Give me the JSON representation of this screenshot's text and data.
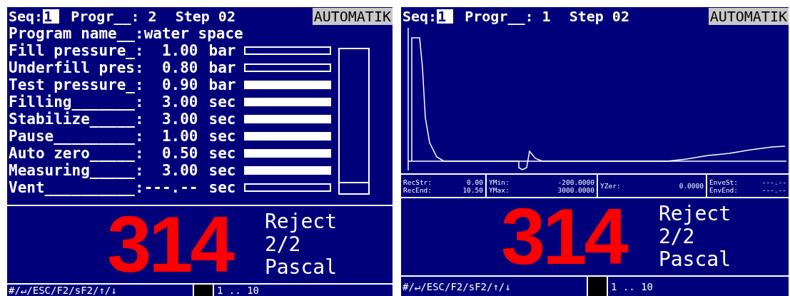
{
  "panels": [
    {
      "kind": "parameters",
      "header": {
        "seq_label": "Seq:",
        "seq_value": "1",
        "program": "Progr__: 2",
        "step": "Step 02",
        "mode": "AUTOMATIK"
      },
      "program_name": "Program name__:water space",
      "parameters": [
        {
          "label": "Fill pressure_:",
          "value": "1.00",
          "unit": "bar",
          "filled": false
        },
        {
          "label": "Underfill pres:",
          "value": "0.80",
          "unit": "bar",
          "filled": false
        },
        {
          "label": "Test pressure_:",
          "value": "0.90",
          "unit": "bar",
          "filled": true
        },
        {
          "label": "Filling_______:",
          "value": "3.00",
          "unit": "sec",
          "filled": true
        },
        {
          "label": "Stabilize_____:",
          "value": "3.00",
          "unit": "sec",
          "filled": true
        },
        {
          "label": "Pause_________:",
          "value": "1.00",
          "unit": "sec",
          "filled": true
        },
        {
          "label": "Auto zero_____:",
          "value": "0.50",
          "unit": "sec",
          "filled": true
        },
        {
          "label": "Measuring_____:",
          "value": "3.00",
          "unit": "sec",
          "filled": true
        },
        {
          "label": "Vent__________:",
          "value": "---.--",
          "unit": "sec",
          "filled": false
        }
      ],
      "result": {
        "number": "314",
        "lines": [
          "Reject",
          "2/2",
          "Pascal"
        ]
      },
      "footer": {
        "keys": "#/↵/ESC/F2/sF2/↑/↓",
        "range": "1 .. 10"
      }
    },
    {
      "kind": "graph",
      "header": {
        "seq_label": "Seq:",
        "seq_value": "1",
        "program": "Progr__: 1",
        "step": "Step 02",
        "mode": "AUTOMATIK"
      },
      "stats": [
        {
          "rows": [
            {
              "label": "RecStr:",
              "value": "0.00"
            },
            {
              "label": "RecEnd:",
              "value": "10.50"
            }
          ]
        },
        {
          "rows": [
            {
              "label": "YMin:",
              "value": "-200.0000"
            },
            {
              "label": "YMax:",
              "value": "3000.0000"
            }
          ]
        },
        {
          "rows": [
            {
              "label": "YZer:",
              "value": "0.0000"
            }
          ]
        },
        {
          "rows": [
            {
              "label": "EnveSt:",
              "value": "---.--"
            },
            {
              "label": "EnvEnd:",
              "value": "---.--"
            }
          ]
        }
      ],
      "result": {
        "number": "314",
        "lines": [
          "Reject",
          "2/2",
          "Pascal"
        ]
      },
      "footer": {
        "keys": "#/↵/ESC/F2/sF2/↑/↓",
        "range": "1 .. 10"
      }
    }
  ]
}
